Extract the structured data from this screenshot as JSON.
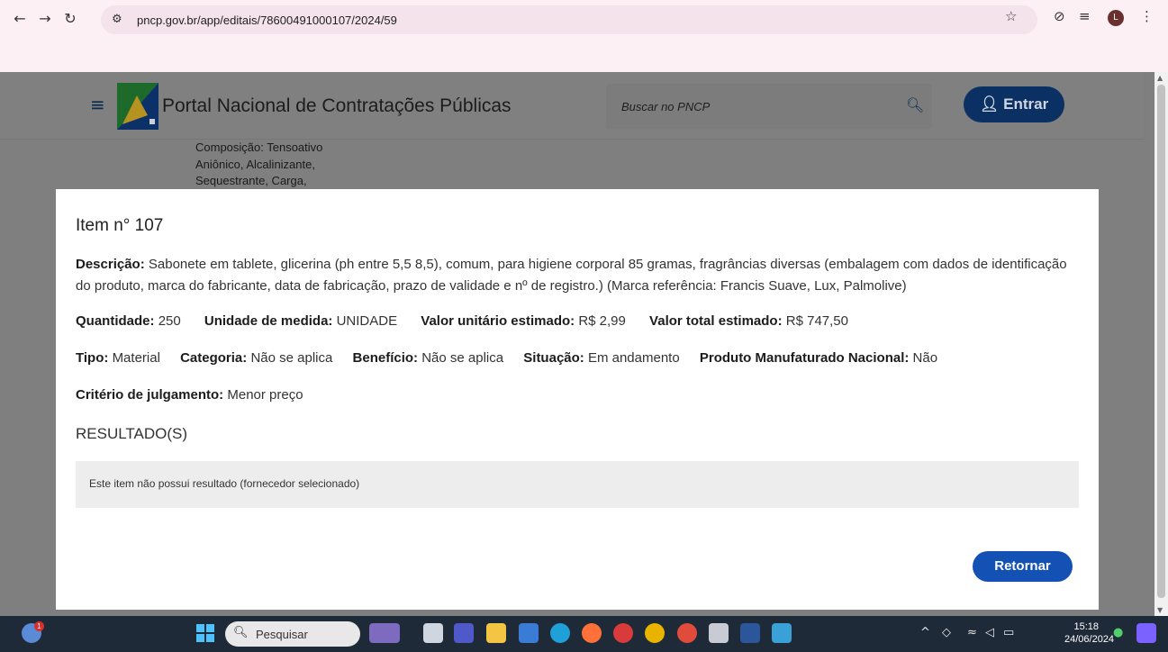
{
  "browser": {
    "url": "pncp.gov.br/app/editais/78600491000107/2024/59",
    "profile_initial": "L"
  },
  "header": {
    "title": "Portal Nacional de Contratações Públicas",
    "search_placeholder": "Buscar no PNCP",
    "login_label": "Entrar"
  },
  "background_text": [
    "Composição: Tensoativo",
    "Aniônico, Alcalinizante,",
    "Sequestrante, Carga,"
  ],
  "item": {
    "title": "Item n° 107",
    "descricao_label": "Descrição:",
    "descricao": "Sabonete em tablete, glicerina (ph entre 5,5 8,5), comum, para higiene corporal 85 gramas, fragrâncias diversas (embalagem com dados de identificação do produto, marca do fabricante, data de fabricação, prazo de validade e nº de registro.) (Marca referência: Francis Suave, Lux, Palmolive)",
    "quantidade_label": "Quantidade:",
    "quantidade": "250",
    "unidade_label": "Unidade de medida:",
    "unidade": "UNIDADE",
    "valor_unitario_label": "Valor unitário estimado:",
    "valor_unitario": "R$ 2,99",
    "valor_total_label": "Valor total estimado:",
    "valor_total": "R$ 747,50",
    "tipo_label": "Tipo:",
    "tipo": "Material",
    "categoria_label": "Categoria:",
    "categoria": "Não se aplica",
    "beneficio_label": "Benefício:",
    "beneficio": "Não se aplica",
    "situacao_label": "Situação:",
    "situacao": "Em andamento",
    "produto_label": "Produto Manufaturado Nacional:",
    "produto": "Não",
    "criterio_label": "Critério de julgamento:",
    "criterio": "Menor preço"
  },
  "results": {
    "title": "RESULTADO(S)",
    "empty_message": "Este item não possui resultado (fornecedor selecionado)"
  },
  "modal_actions": {
    "back_label": "Retornar"
  },
  "taskbar": {
    "search_label": "Pesquisar",
    "time": "15:18",
    "date": "24/06/2024",
    "weather_badge": "1"
  },
  "colors": {
    "primary_button": "#1351b4",
    "header_button": "#0b3063",
    "overlay": "#7f7f7f"
  }
}
